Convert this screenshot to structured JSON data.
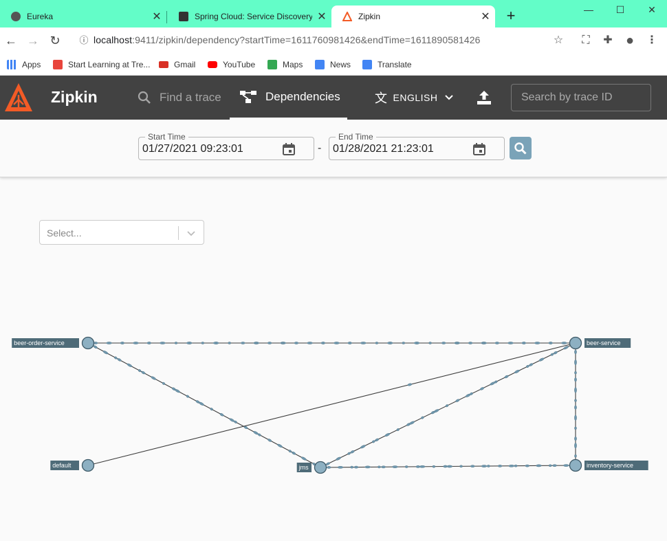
{
  "browser": {
    "tabs": [
      {
        "title": "Eureka",
        "icon": "globe-icon",
        "active": false
      },
      {
        "title": "Spring Cloud: Service Discovery w",
        "icon": "sa-icon",
        "active": false
      },
      {
        "title": "Zipkin",
        "icon": "zipkin-icon",
        "active": true
      }
    ],
    "url_host": "localhost",
    "url_rest": ":9411/zipkin/dependency?startTime=1611760981426&endTime=1611890581426",
    "bookmarks": [
      {
        "label": "Apps",
        "color": "#4285f4"
      },
      {
        "label": "Start Learning at Tre...",
        "color": "#e8453c"
      },
      {
        "label": "Gmail",
        "color": "#d93025"
      },
      {
        "label": "YouTube",
        "color": "#ff0000"
      },
      {
        "label": "Maps",
        "color": "#34a853"
      },
      {
        "label": "News",
        "color": "#4285f4"
      },
      {
        "label": "Translate",
        "color": "#4285f4"
      }
    ]
  },
  "zipkin": {
    "brand": "Zipkin",
    "nav_find": "Find a trace",
    "nav_dependencies": "Dependencies",
    "language": "ENGLISH",
    "trace_search_placeholder": "Search by trace ID",
    "accent": "#424242",
    "logo_color": "#f35b26"
  },
  "timebar": {
    "start_label": "Start Time",
    "start_value": "01/27/2021 09:23:01",
    "separator": "-",
    "end_label": "End Time",
    "end_value": "01/28/2021 21:23:01"
  },
  "filter": {
    "placeholder": "Select..."
  },
  "graph": {
    "nodes": [
      {
        "id": "beer-order-service",
        "label": "beer-order-service"
      },
      {
        "id": "beer-service",
        "label": "beer-service"
      },
      {
        "id": "default",
        "label": "default"
      },
      {
        "id": "jms",
        "label": "jms"
      },
      {
        "id": "inventory-service",
        "label": "inventory-service"
      }
    ],
    "edges": [
      {
        "from": "beer-order-service",
        "to": "beer-service"
      },
      {
        "from": "beer-order-service",
        "to": "jms"
      },
      {
        "from": "default",
        "to": "beer-service"
      },
      {
        "from": "jms",
        "to": "beer-service"
      },
      {
        "from": "jms",
        "to": "inventory-service"
      },
      {
        "from": "beer-service",
        "to": "inventory-service"
      }
    ],
    "node_color": "#8db0c2",
    "label_bg": "#4e6b78"
  }
}
